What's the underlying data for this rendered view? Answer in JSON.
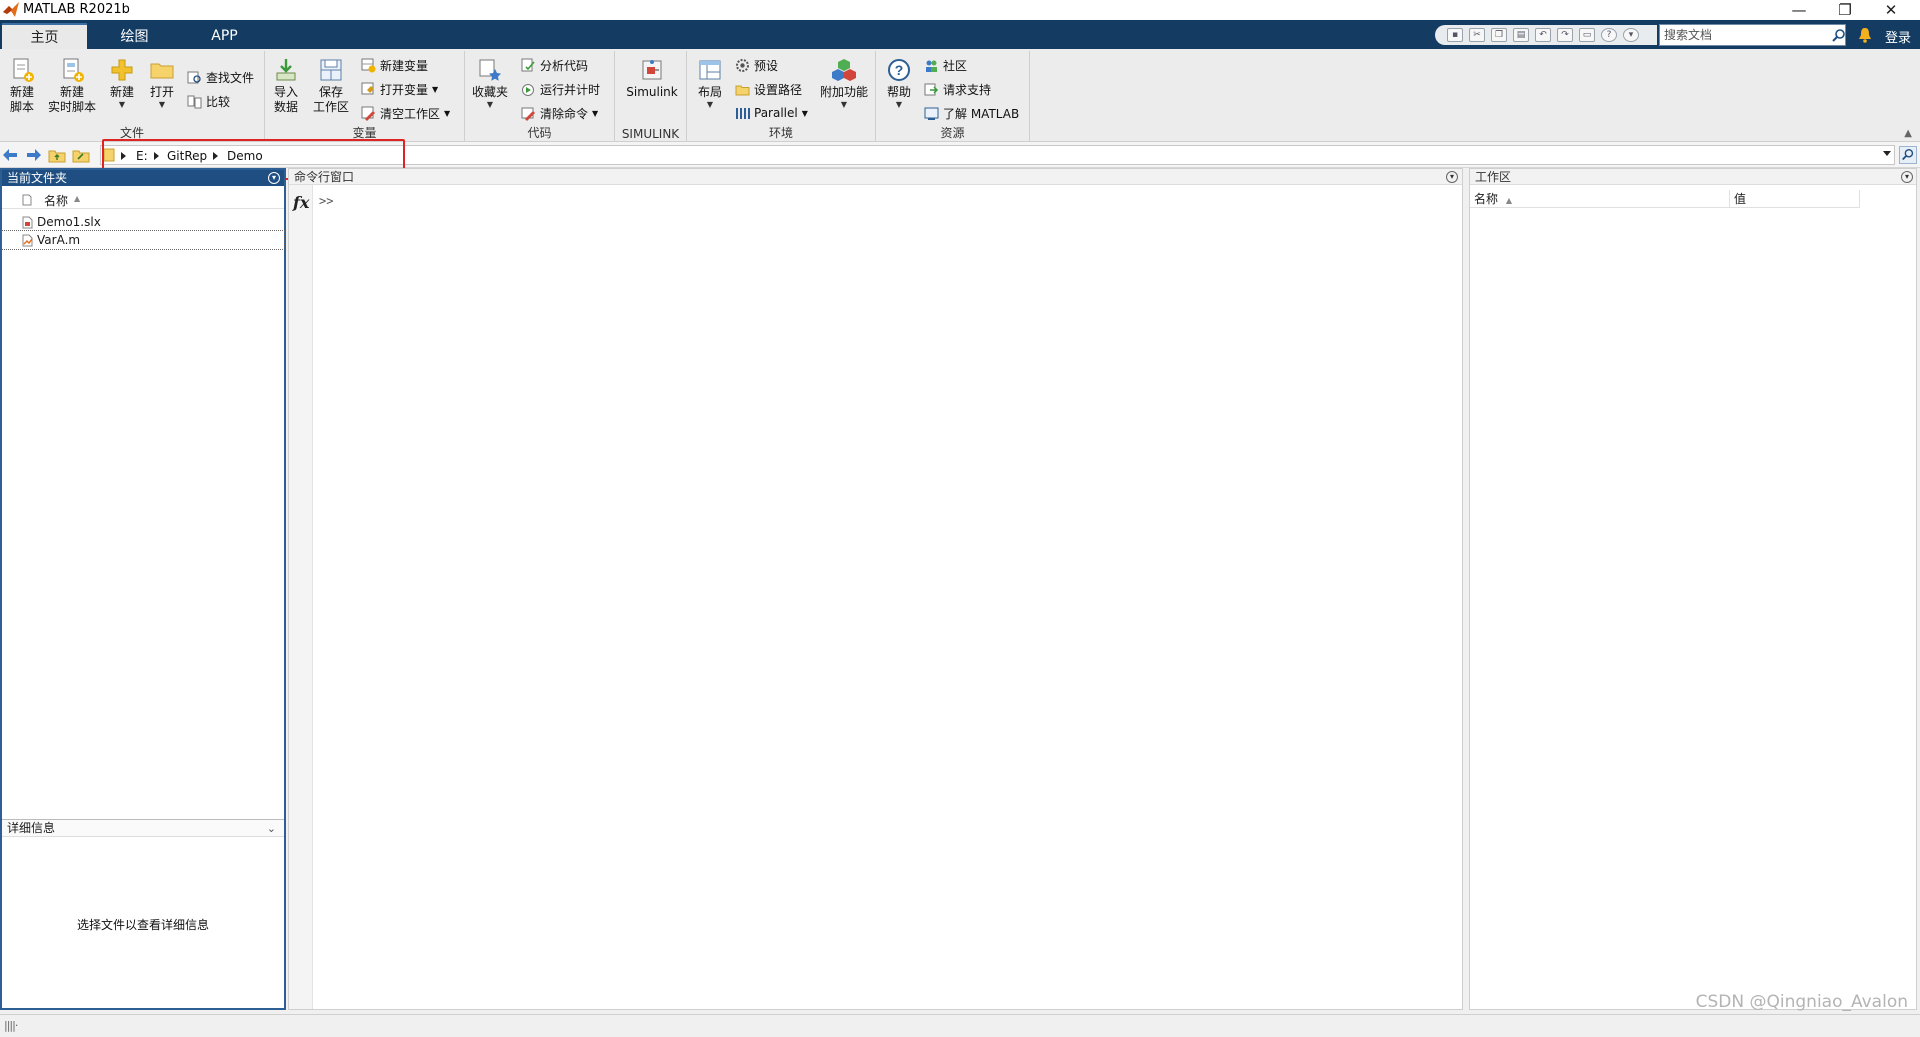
{
  "app": {
    "title": "MATLAB R2021b"
  },
  "window_controls": {
    "minimize": "—",
    "restore": "❐",
    "close": "✕"
  },
  "tabs": [
    {
      "label": "主页",
      "active": true
    },
    {
      "label": "绘图",
      "active": false
    },
    {
      "label": "APP",
      "active": false
    }
  ],
  "search": {
    "placeholder": "搜索文档"
  },
  "login_label": "登录",
  "ribbon": {
    "file": {
      "group_label": "文件",
      "new_script": "新建\n脚本",
      "new_live_script": "新建\n实时脚本",
      "new": "新建",
      "open": "打开",
      "find_files": "查找文件",
      "compare": "比较"
    },
    "variable": {
      "group_label": "变量",
      "import_data": "导入\n数据",
      "save_workspace": "保存\n工作区",
      "new_variable": "新建变量",
      "open_variable": "打开变量",
      "clear_workspace": "清空工作区"
    },
    "code": {
      "group_label": "代码",
      "favorites": "收藏夹",
      "analyze_code": "分析代码",
      "run_and_time": "运行并计时",
      "clear_commands": "清除命令"
    },
    "simulink": {
      "group_label": "SIMULINK",
      "simulink": "Simulink"
    },
    "environment": {
      "group_label": "环境",
      "layout": "布局",
      "preferences": "预设",
      "set_path": "设置路径",
      "parallel": "Parallel",
      "addons": "附加功能"
    },
    "resources": {
      "group_label": "资源",
      "help": "帮助",
      "community": "社区",
      "request_support": "请求支持",
      "learn_matlab": "了解 MATLAB"
    }
  },
  "address": {
    "crumbs": [
      "E:",
      "GitRep",
      "Demo"
    ]
  },
  "current_folder": {
    "title": "当前文件夹",
    "column_name": "名称",
    "files": [
      {
        "name": "Demo1.slx",
        "icon": "simulink-model-icon"
      },
      {
        "name": "VarA.m",
        "icon": "matlab-script-icon"
      }
    ],
    "details_title": "详细信息",
    "details_message": "选择文件以查看详细信息"
  },
  "command_window": {
    "title": "命令行窗口",
    "fx": "fx",
    "prompt": ">>"
  },
  "workspace": {
    "title": "工作区",
    "col_name": "名称",
    "col_value": "值"
  },
  "status": {
    "grip": "||||·"
  },
  "watermark": "CSDN @Qingniao_Avalon",
  "colors": {
    "tabstrip": "#143c63",
    "panel_header_active": "#1f4f82",
    "highlight_box": "#e02222",
    "ribbon_bg": "#ececec"
  }
}
